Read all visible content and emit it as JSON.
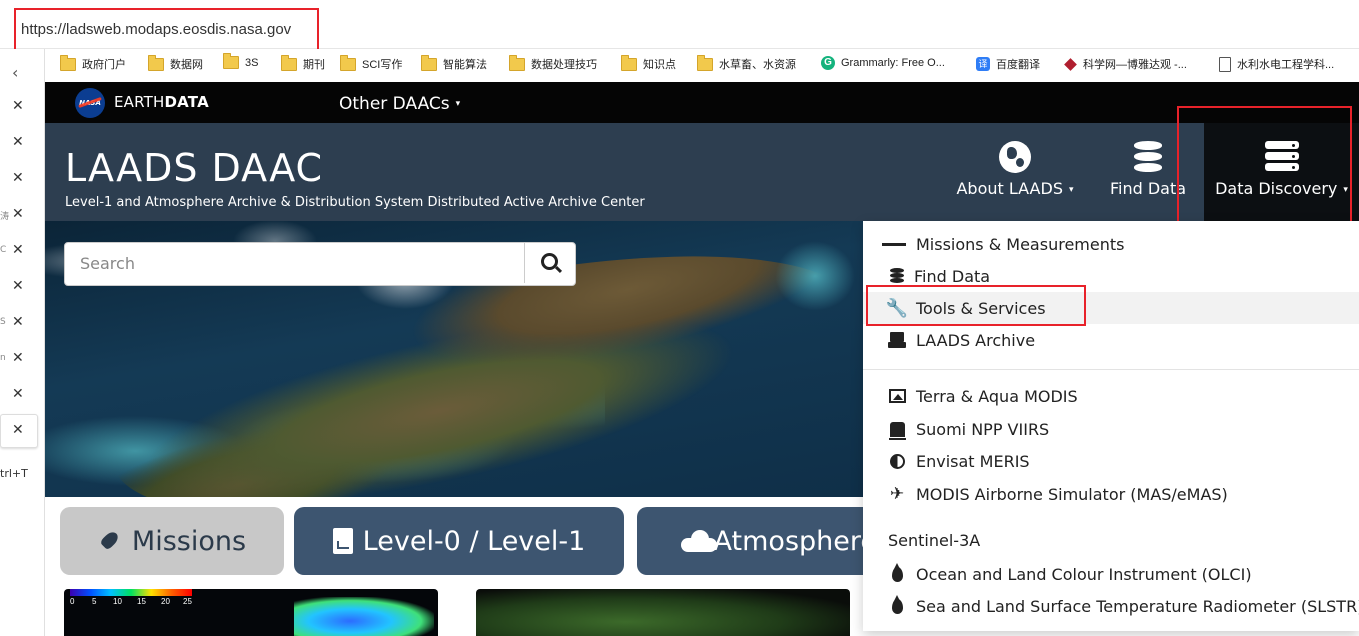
{
  "browser": {
    "url": "https://ladsweb.modaps.eosdis.nasa.gov",
    "new_tab_hint": "trl+T",
    "bookmarks": [
      {
        "label": "政府门户",
        "icon": "folder-icon"
      },
      {
        "label": "数据网",
        "icon": "folder-icon"
      },
      {
        "label": "3S",
        "icon": "folder-icon"
      },
      {
        "label": "期刊",
        "icon": "folder-icon"
      },
      {
        "label": "SCI写作",
        "icon": "folder-icon"
      },
      {
        "label": "智能算法",
        "icon": "folder-icon"
      },
      {
        "label": "数据处理技巧",
        "icon": "folder-icon"
      },
      {
        "label": "知识点",
        "icon": "folder-icon"
      },
      {
        "label": "水草畜、水资源",
        "icon": "folder-icon"
      },
      {
        "label": "Grammarly: Free O...",
        "icon": "grammarly-icon"
      },
      {
        "label": "百度翻译",
        "icon": "translate-icon"
      },
      {
        "label": "科学网—博雅达观 -...",
        "icon": "sciencenet-icon"
      },
      {
        "label": "水利水电工程学科...",
        "icon": "page-icon"
      }
    ],
    "tab_fragments": [
      "涛",
      "C",
      "S",
      "n"
    ]
  },
  "earthdata": {
    "logo_text": "NASA",
    "wordmark_light": "EARTH",
    "wordmark_bold": "DATA",
    "other_daacs": "Other DAACs"
  },
  "laads": {
    "title": "LAADS DAAC",
    "subtitle": "Level-1 and Atmosphere Archive & Distribution System Distributed Active Archive Center",
    "nav": {
      "about": "About LAADS",
      "find_data": "Find Data",
      "data_discovery": "Data Discovery"
    }
  },
  "search": {
    "placeholder": "Search"
  },
  "categories": {
    "missions": "Missions",
    "level": "Level-0 / Level-1",
    "atmosphere": "Atmosphere"
  },
  "colorbar_ticks": [
    "0",
    "5",
    "10",
    "15",
    "20",
    "25"
  ],
  "dropdown": {
    "missions": "Missions & Measurements",
    "find_data": "Find Data",
    "tools": "Tools & Services",
    "archive": "LAADS Archive",
    "modis": "Terra & Aqua MODIS",
    "viirs": "Suomi NPP VIIRS",
    "meris": "Envisat MERIS",
    "mas": "MODIS Airborne Simulator (MAS/eMAS)",
    "sentinel_heading": "Sentinel-3A",
    "olci": "Ocean and Land Colour Instrument (OLCI)",
    "slstr": "Sea and Land Surface Temperature Radiometer (SLSTR)"
  },
  "colors": {
    "highlight": "#e8222a",
    "header_bg": "#2d3e50",
    "earthdata_bg": "#050505",
    "category_blue": "#3d5570",
    "category_grey": "#c8c8c8"
  }
}
